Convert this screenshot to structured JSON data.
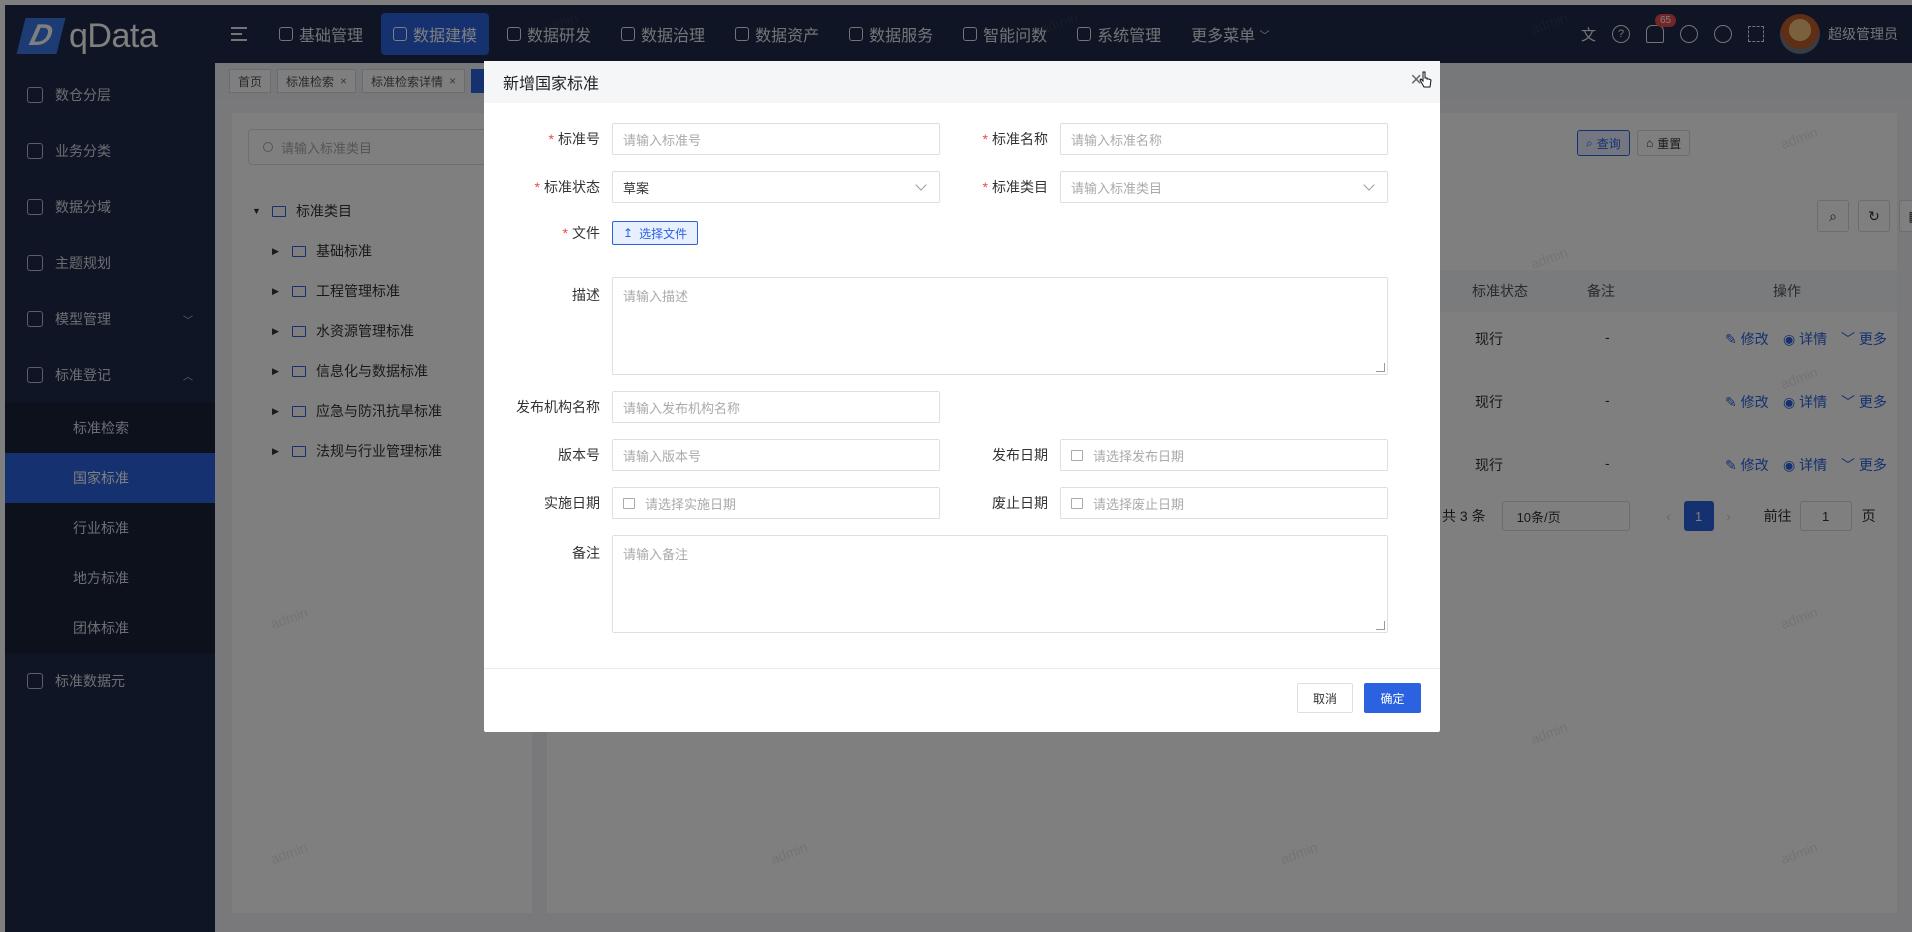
{
  "app": {
    "logo": "qData",
    "logo_mark": "D"
  },
  "topnav": {
    "items": [
      {
        "label": "基础管理",
        "icon": "grid-icon"
      },
      {
        "label": "数据建模",
        "icon": "cube-icon",
        "active": true
      },
      {
        "label": "数据研发",
        "icon": "code-icon"
      },
      {
        "label": "数据治理",
        "icon": "shield-icon"
      },
      {
        "label": "数据资产",
        "icon": "asset-icon"
      },
      {
        "label": "数据服务",
        "icon": "service-icon"
      },
      {
        "label": "智能问数",
        "icon": "robot-icon"
      },
      {
        "label": "系统管理",
        "icon": "settings-icon"
      }
    ],
    "more": "更多菜单",
    "notif_count": "65",
    "user": "超级管理员"
  },
  "sidebar": {
    "items": [
      {
        "label": "数仓分层"
      },
      {
        "label": "业务分类"
      },
      {
        "label": "数据分域"
      },
      {
        "label": "主题规划"
      },
      {
        "label": "模型管理"
      },
      {
        "label": "标准登记"
      },
      {
        "label": "标准数据元"
      }
    ],
    "sub": [
      {
        "label": "标准检索"
      },
      {
        "label": "国家标准"
      },
      {
        "label": "行业标准"
      },
      {
        "label": "地方标准"
      },
      {
        "label": "团体标准"
      }
    ]
  },
  "tabs": [
    {
      "label": "首页"
    },
    {
      "label": "标准检索"
    },
    {
      "label": "标准检索详情"
    }
  ],
  "tree": {
    "search_placeholder": "请输入标准类目",
    "root": "标准类目",
    "children": [
      "基础标准",
      "工程管理标准",
      "水资源管理标准",
      "信息化与数据标准",
      "应急与防汛抗旱标准",
      "法规与行业管理标准"
    ]
  },
  "table": {
    "query_btn": "查询",
    "reset_btn": "重置",
    "headers": {
      "status": "标准状态",
      "remark": "备注",
      "ops": "操作"
    },
    "rows": [
      {
        "status": "现行",
        "remark": "-"
      },
      {
        "status": "现行",
        "remark": "-"
      },
      {
        "status": "现行",
        "remark": "-"
      }
    ],
    "op_edit": "修改",
    "op_detail": "详情",
    "op_more": "更多",
    "pager": {
      "total": "共 3 条",
      "page_size": "10条/页",
      "current": "1",
      "goto_label": "前往",
      "goto_value": "1",
      "page_unit": "页"
    }
  },
  "watermark": "admin",
  "dialog": {
    "title": "新增国家标准",
    "fields": {
      "std_no": {
        "label": "标准号",
        "placeholder": "请输入标准号"
      },
      "std_name": {
        "label": "标准名称",
        "placeholder": "请输入标准名称"
      },
      "std_status": {
        "label": "标准状态",
        "value": "草案"
      },
      "std_category": {
        "label": "标准类目",
        "placeholder": "请输入标准类目"
      },
      "file": {
        "label": "文件",
        "button": "选择文件"
      },
      "desc": {
        "label": "描述",
        "placeholder": "请输入描述"
      },
      "org": {
        "label": "发布机构名称",
        "placeholder": "请输入发布机构名称"
      },
      "version": {
        "label": "版本号",
        "placeholder": "请输入版本号"
      },
      "publish_date": {
        "label": "发布日期",
        "placeholder": "请选择发布日期"
      },
      "impl_date": {
        "label": "实施日期",
        "placeholder": "请选择实施日期"
      },
      "abolish_date": {
        "label": "废止日期",
        "placeholder": "请选择废止日期"
      },
      "remark": {
        "label": "备注",
        "placeholder": "请输入备注"
      }
    },
    "cancel": "取消",
    "confirm": "确定"
  },
  "colors": {
    "primary": "#2a62e0",
    "sidebar": "#1e2a48",
    "required": "#e84d4d"
  }
}
